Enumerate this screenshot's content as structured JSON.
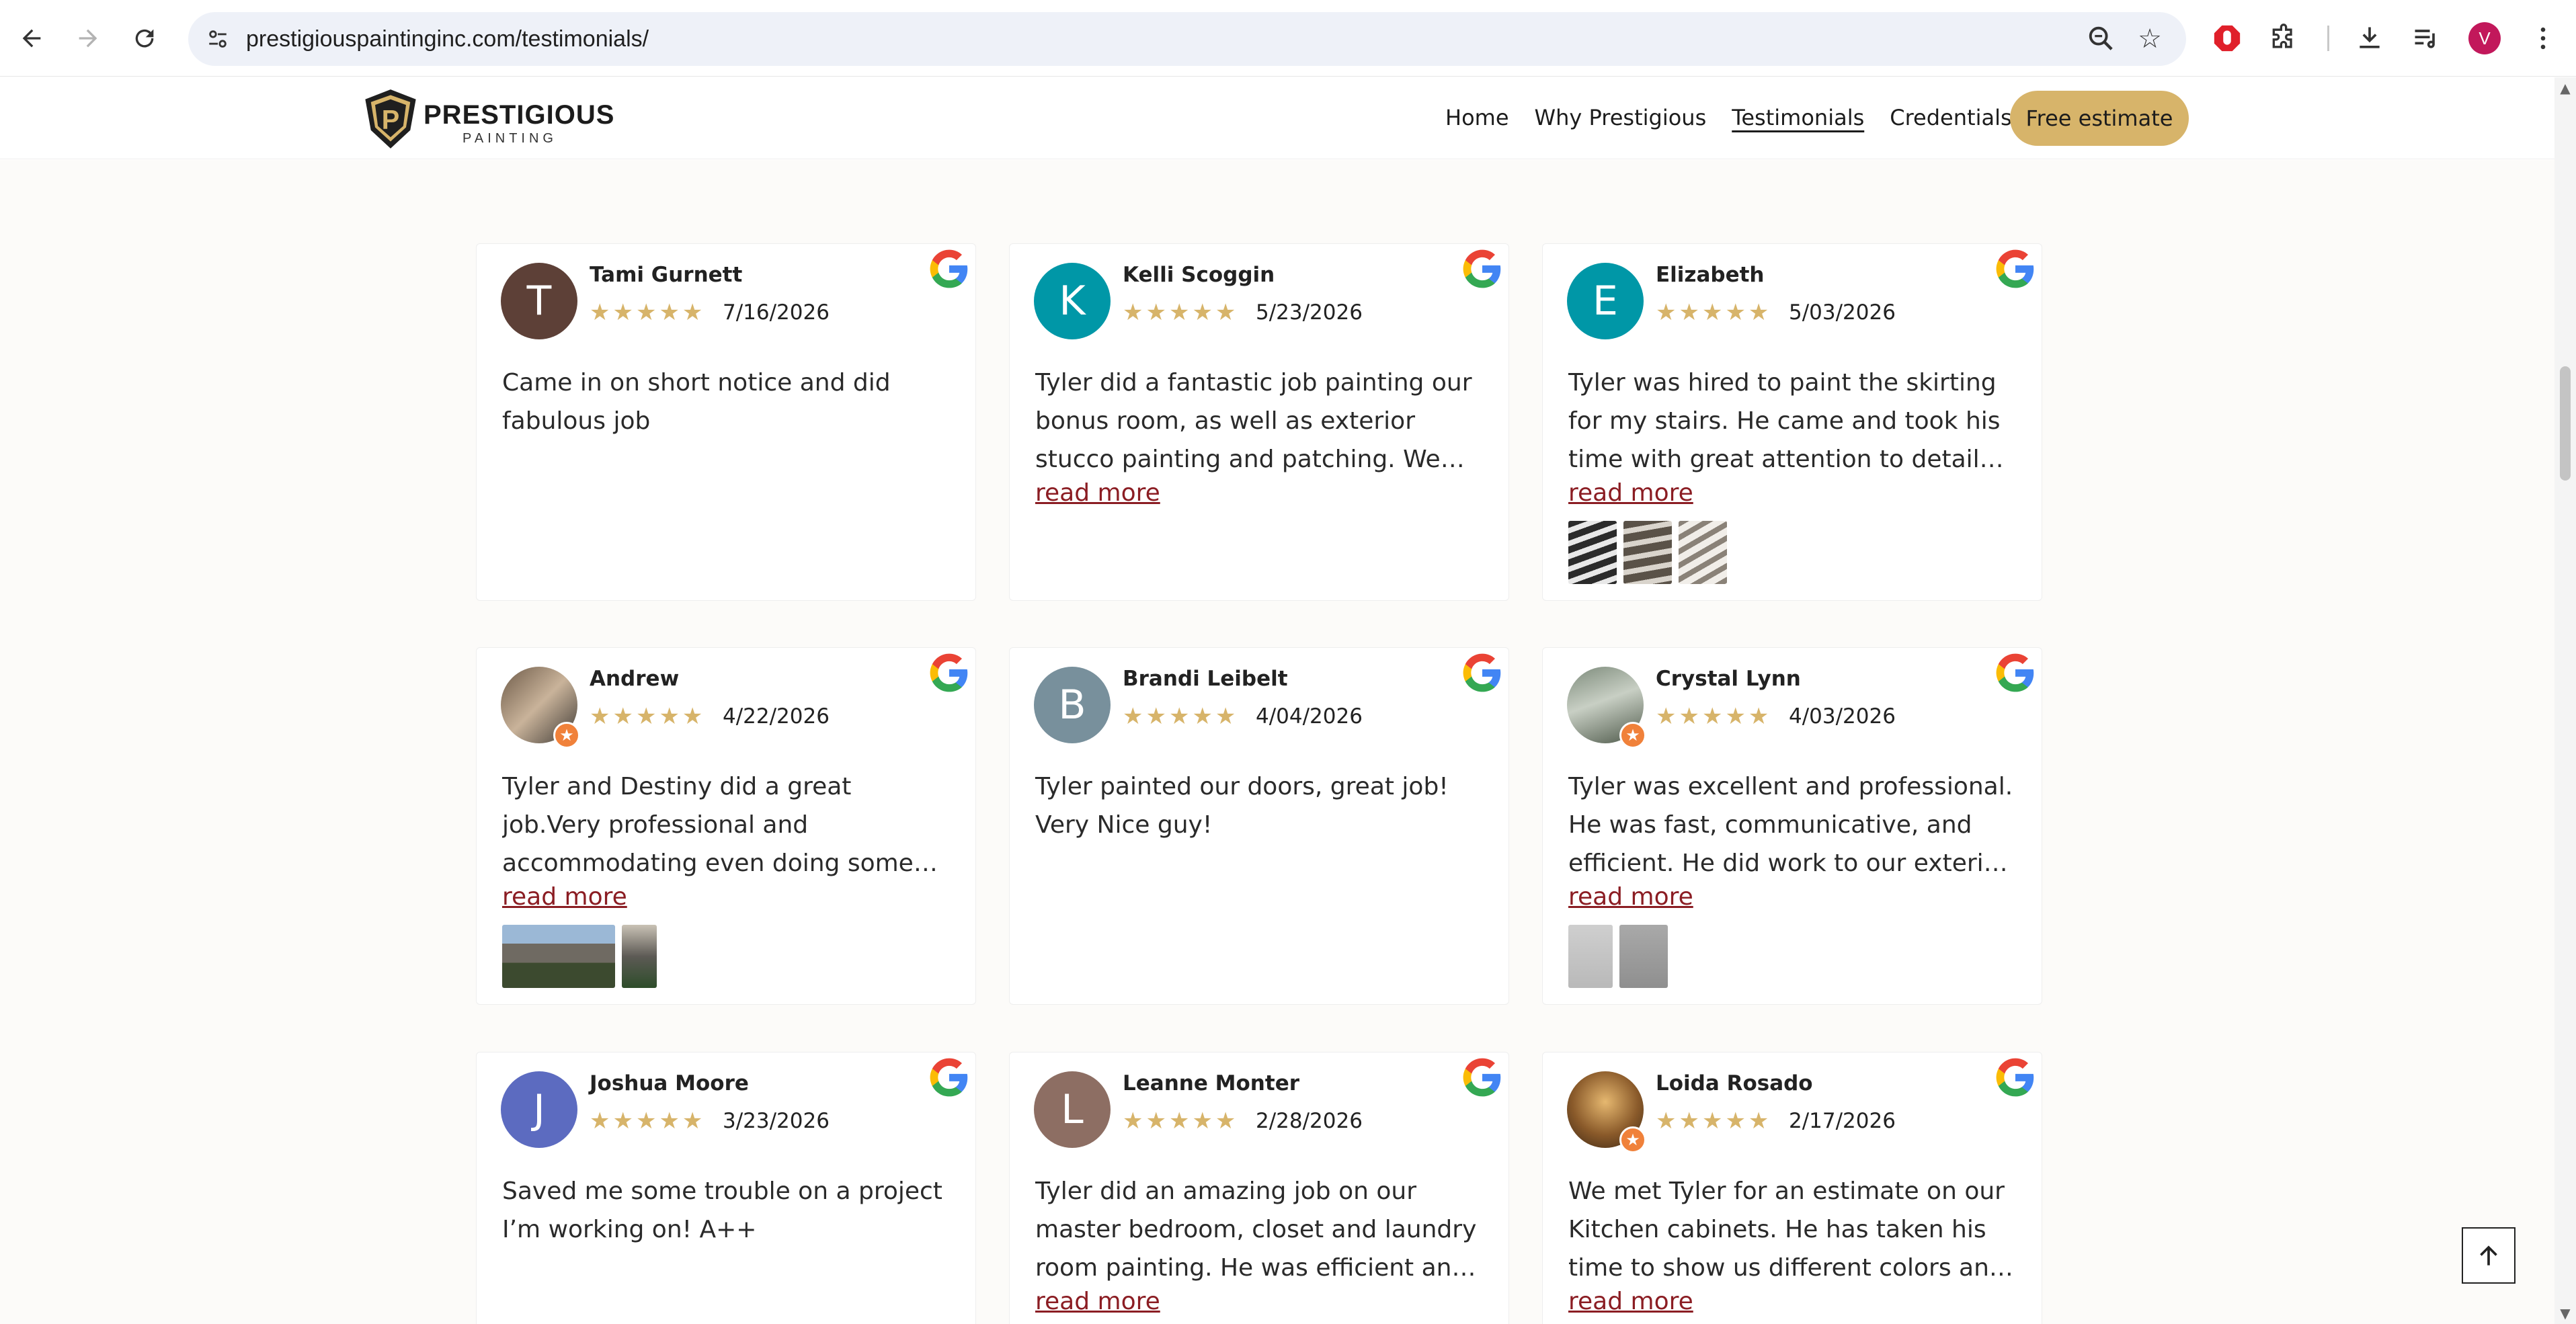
{
  "browser": {
    "url": "prestigiouspaintinginc.com/testimonials/",
    "profile_initial": "V"
  },
  "site": {
    "logo_word": "PRESTIGIOUS",
    "logo_sub": "PAINTING",
    "nav": {
      "home": "Home",
      "why": "Why Prestigious",
      "testimonials": "Testimonials",
      "credentials": "Credentials",
      "cta": "Free estimate"
    }
  },
  "colors": {
    "accent_gold": "#d7b46a",
    "link_red": "#8b1d23"
  },
  "reviews": [
    {
      "initial": "T",
      "name": "Tami Gurnett",
      "stars": "★★★★★",
      "date": "7/16/2026",
      "text": "Came in on short notice and did fabulous job",
      "read_more": ""
    },
    {
      "initial": "K",
      "name": "Kelli Scoggin",
      "stars": "★★★★★",
      "date": "5/23/2026",
      "text": "Tyler did a fantastic job painting our bonus room, as well as exterior stucco painting and patching. We are very happy with the results.",
      "read_more": "read more"
    },
    {
      "initial": "E",
      "name": "Elizabeth",
      "stars": "★★★★★",
      "date": "5/03/2026",
      "text": "Tyler was hired to paint the skirting for my stairs. He came and took his time with great attention to detail Tyler is not just a painter.",
      "read_more": "read more"
    },
    {
      "initial": "",
      "name": "Andrew",
      "stars": "★★★★★",
      "date": "4/22/2026",
      "text": "Tyler and Destiny did a great job.Very professional and accommodating even doing some extra work on the fly.Would recommend.",
      "read_more": "read more"
    },
    {
      "initial": "B",
      "name": "Brandi Leibelt",
      "stars": "★★★★★",
      "date": "4/04/2026",
      "text": "Tyler painted our doors, great job! Very Nice guy!",
      "read_more": ""
    },
    {
      "initial": "",
      "name": "Crystal Lynn",
      "stars": "★★★★★",
      "date": "4/03/2026",
      "text": "Tyler was excellent and professional. He was fast, communicative, and efficient. He did work to our exterior home. Before and after photos.",
      "read_more": "read more"
    },
    {
      "initial": "J",
      "name": "Joshua Moore",
      "stars": "★★★★★",
      "date": "3/23/2026",
      "text": "Saved me some trouble on a project I’m working on! A++",
      "read_more": ""
    },
    {
      "initial": "L",
      "name": "Leanne Monter",
      "stars": "★★★★★",
      "date": "2/28/2026",
      "text": "Tyler did an amazing job on our master bedroom, closet and laundry room painting. He was efficient and made sure everything was perfect.",
      "read_more": "read more"
    },
    {
      "initial": "",
      "name": "Loida Rosado",
      "stars": "★★★★★",
      "date": "2/17/2026",
      "text": "We met Tyler for an estimate on our Kitchen cabinets. He has taken his time to show us different colors and he has a great eye.",
      "read_more": "read more"
    }
  ]
}
